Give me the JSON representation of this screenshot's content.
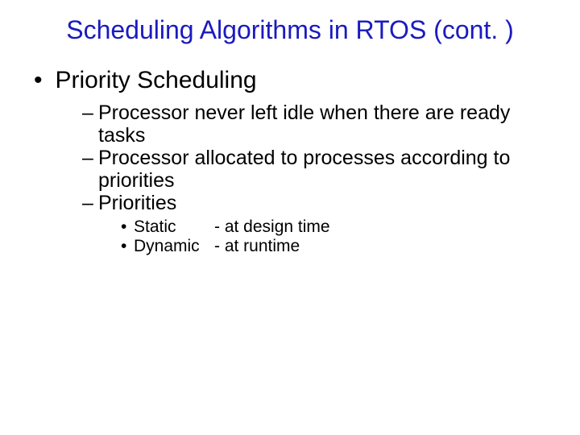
{
  "title": "Scheduling Algorithms in RTOS (cont. )",
  "level1": {
    "bullet": "•",
    "text": "Priority Scheduling"
  },
  "level2": [
    {
      "dash": "–",
      "text": "Processor never left idle when there are ready tasks"
    },
    {
      "dash": "–",
      "text": "Processor allocated to processes according to priorities"
    },
    {
      "dash": "–",
      "text": "Priorities"
    }
  ],
  "level3": [
    {
      "dot": "•",
      "label": "Static",
      "desc": "- at design time"
    },
    {
      "dot": "•",
      "label": "Dynamic",
      "desc": "- at runtime"
    }
  ]
}
